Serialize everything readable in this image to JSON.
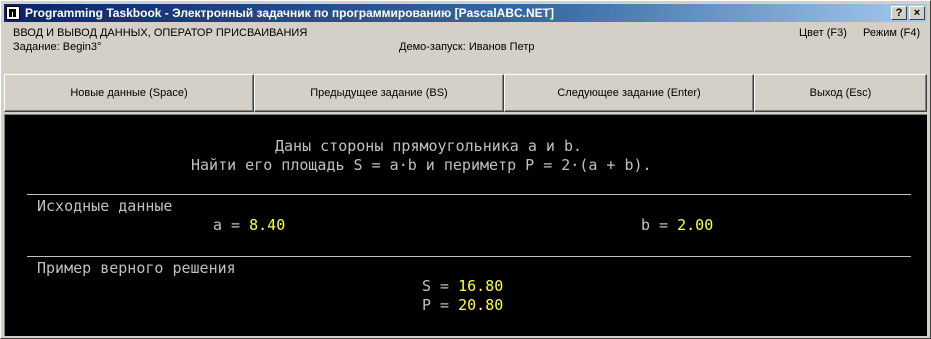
{
  "window": {
    "title": "Programming Taskbook - Электронный задачник по программированию [PascalABC.NET]",
    "help_glyph": "?",
    "close_glyph": "×"
  },
  "info": {
    "section": "ВВОД И ВЫВОД ДАННЫХ, ОПЕРАТОР ПРИСВАИВАНИЯ",
    "task": "Задание: Begin3°",
    "demo": "Демо-запуск: Иванов Петр",
    "color": "Цвет (F3)",
    "mode": "Режим (F4)"
  },
  "buttons": {
    "new_data": "Новые данные (Space)",
    "prev_task": "Предыдущее задание (BS)",
    "next_task": "Следующее задание (Enter)",
    "exit": "Выход (Esc)"
  },
  "console": {
    "statement_line1": "Даны стороны прямоугольника a и b.",
    "statement_line2": "Найти его площадь S = a·b и периметр P = 2·(a + b).",
    "input_header": "Исходные данные",
    "a_label": "a = ",
    "a_value": "8.40",
    "b_label": "b = ",
    "b_value": "2.00",
    "sample_header": "Пример верного решения",
    "s_label": "S = ",
    "s_value": "16.80",
    "p_label": "P = ",
    "p_value": "20.80"
  },
  "colors": {
    "titlebar_start": "#0a246a",
    "console_bg": "#000000",
    "console_text": "#c0c0c0",
    "number_highlight": "#ffff40"
  }
}
